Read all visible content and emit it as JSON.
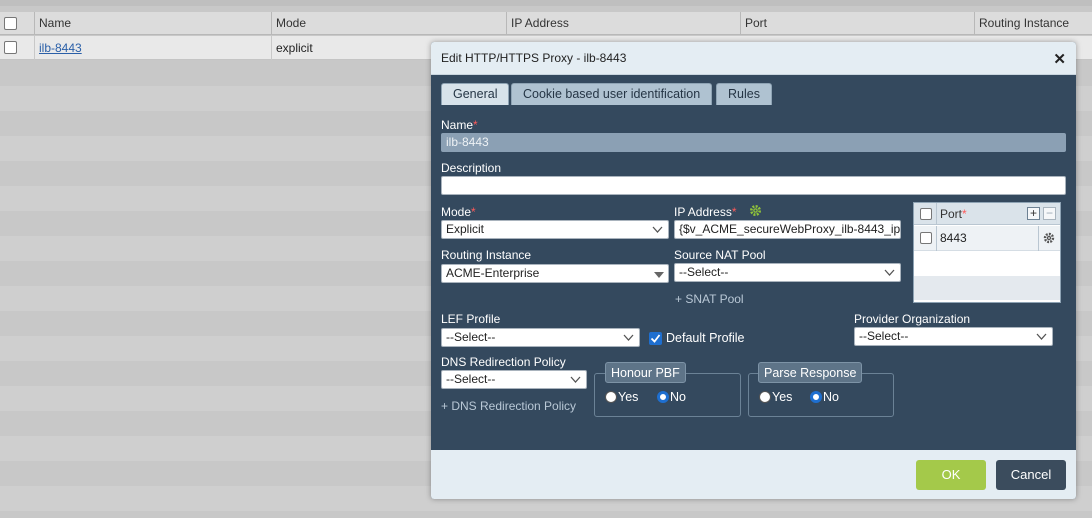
{
  "grid": {
    "columns": [
      "Name",
      "Mode",
      "IP Address",
      "Port",
      "Routing Instance"
    ],
    "row": {
      "name": "ilb-8443",
      "mode": "explicit"
    }
  },
  "dialog": {
    "title": "Edit HTTP/HTTPS Proxy - ilb-8443",
    "close_icon": "close-icon",
    "tabs": [
      "General",
      "Cookie based user identification",
      "Rules"
    ],
    "active_tab": "General",
    "name_label": "Name",
    "name_value": "ilb-8443",
    "description_label": "Description",
    "description_value": "",
    "mode_label": "Mode",
    "mode_value": "Explicit",
    "ip_label": "IP Address",
    "ip_value": "{$v_ACME_secureWebProxy_ilb-8443_ip",
    "ip_icon": "gear-icon",
    "routing_label": "Routing Instance",
    "routing_value": "ACME-Enterprise",
    "snat_label": "Source NAT Pool",
    "snat_value": "--Select--",
    "snat_link": "+ SNAT Pool",
    "port_table": {
      "header": "Port",
      "add_icon": "plus-icon",
      "remove_icon": "minus-icon",
      "rows": [
        "8443"
      ],
      "row_icon": "gear-icon"
    },
    "lef_label": "LEF Profile",
    "lef_value": "--Select--",
    "default_profile_label": "Default Profile",
    "default_profile_checked": true,
    "provider_label": "Provider Organization",
    "provider_value": "--Select--",
    "dns_label": "DNS Redirection Policy",
    "dns_value": "--Select--",
    "dns_link": "+ DNS Redirection Policy",
    "honour_pbf": {
      "legend": "Honour PBF",
      "yes": "Yes",
      "no": "No",
      "selected": "No"
    },
    "parse_response": {
      "legend": "Parse Response",
      "yes": "Yes",
      "no": "No",
      "selected": "No"
    },
    "ok_label": "OK",
    "cancel_label": "Cancel"
  },
  "colors": {
    "dialog_body": "#34495e",
    "accent_blue": "#1e6fd0",
    "ok_button": "#a4c94a",
    "cancel_button": "#3b4c5d",
    "required": "#ff5a5a"
  }
}
